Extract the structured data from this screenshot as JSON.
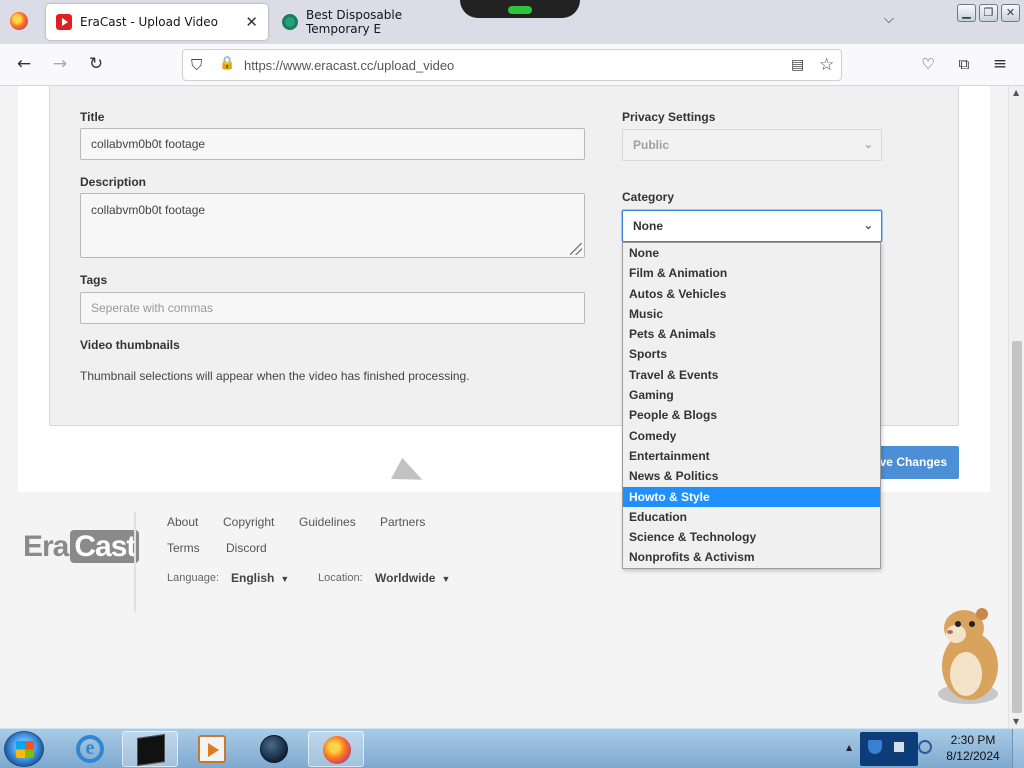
{
  "browser": {
    "tabs": [
      {
        "title": "EraCast - Upload Video",
        "active": true
      },
      {
        "title": "Best Disposable Temporary E",
        "active": false
      }
    ],
    "close_glyph": "✕",
    "tab_list_glyph": "⌵",
    "url": "https://www.eracast.cc/upload_video",
    "window_buttons": [
      "▁",
      "❐",
      "✕"
    ]
  },
  "form": {
    "title_label": "Title",
    "title_value": "collabvm0b0t footage",
    "description_label": "Description",
    "description_value": "collabvm0b0t footage",
    "tags_label": "Tags",
    "tags_placeholder": "Seperate with commas",
    "thumbnails_label": "Video thumbnails",
    "thumbnails_note": "Thumbnail selections will appear when the video has finished processing.",
    "privacy_label": "Privacy Settings",
    "privacy_value": "Public",
    "category_label": "Category",
    "category_value": "None",
    "save_label": "Save Changes"
  },
  "category_options": [
    "None",
    "Film & Animation",
    "Autos & Vehicles",
    "Music",
    "Pets & Animals",
    "Sports",
    "Travel & Events",
    "Gaming",
    "People & Blogs",
    "Comedy",
    "Entertainment",
    "News & Politics",
    "Howto & Style",
    "Education",
    "Science & Technology",
    "Nonprofits & Activism"
  ],
  "highlighted_option": "Howto & Style",
  "footer": {
    "logo_era": "Era",
    "logo_cast": "Cast",
    "links": [
      "About",
      "Copyright",
      "Guidelines",
      "Partners",
      "Terms",
      "Discord"
    ],
    "language_label": "Language:",
    "language_value": "English",
    "location_label": "Location:",
    "location_value": "Worldwide"
  },
  "taskbar": {
    "time": "2:30 PM",
    "date": "8/12/2024",
    "ie_glyph": "e"
  },
  "colors": {
    "accent_blue": "#4d8fd6",
    "highlight": "#1e90ff",
    "focus_border": "#3b84d8"
  },
  "icons": {
    "back": "←",
    "forward": "→",
    "reload": "↻",
    "shield": "⛉",
    "lock": "🔒",
    "reader": "▤",
    "bookmark": "☆",
    "pocket": "♡",
    "extensions": "⧉",
    "menu": "≡",
    "chevron": "⌄",
    "caret": "▼",
    "scroll_up": "▲",
    "scroll_down": "▼"
  }
}
